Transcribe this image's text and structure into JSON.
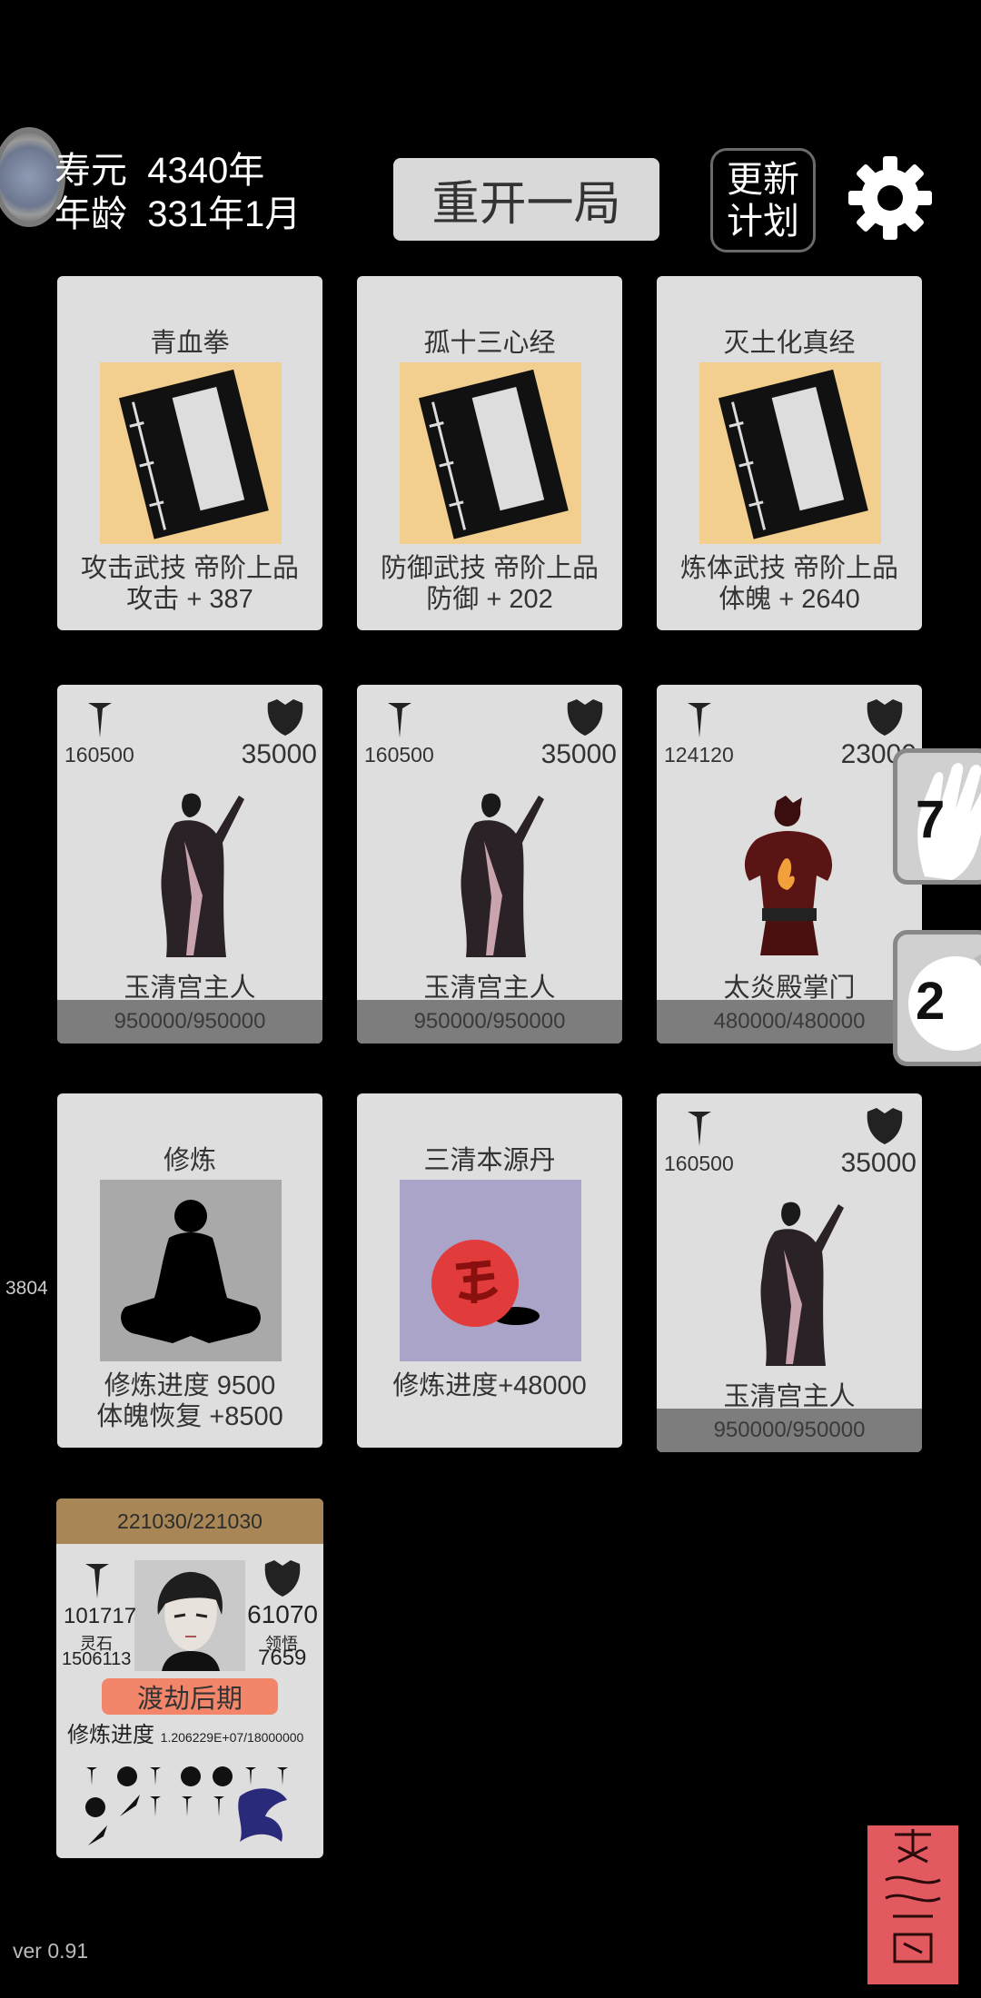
{
  "header": {
    "lifespan_label": "寿元",
    "lifespan_value": "4340年",
    "age_label": "年龄",
    "age_value": "331年1月",
    "restart_label": "重开一局",
    "plan_line1": "更新",
    "plan_line2": "计划"
  },
  "skills": [
    {
      "name": "青血拳",
      "type": "攻击武技  帝阶上品",
      "effect": "攻击 + 387"
    },
    {
      "name": "孤十三心经",
      "type": "防御武技  帝阶上品",
      "effect": "防御 + 202"
    },
    {
      "name": "灭土化真经",
      "type": "炼体武技  帝阶上品",
      "effect": "体魄 + 2640"
    }
  ],
  "enemies": [
    {
      "atk": "160500",
      "def": "35000",
      "name": "玉清宫主人",
      "hp": "950000/950000"
    },
    {
      "atk": "160500",
      "def": "35000",
      "name": "玉清宫主人",
      "hp": "950000/950000"
    },
    {
      "atk": "124120",
      "def": "23000",
      "name": "太炎殿掌门",
      "hp": "480000/480000"
    },
    {
      "atk": "160500",
      "def": "35000",
      "name": "玉清宫主人",
      "hp": "950000/950000"
    }
  ],
  "training": {
    "name": "修炼",
    "line1": "修炼进度  9500",
    "line2": "体魄恢复  +8500"
  },
  "pill": {
    "name": "三清本源丹",
    "line1": "修炼进度+48000"
  },
  "side_buttons": {
    "hand_count": "7",
    "sword_count": "2"
  },
  "left_number": "3804",
  "player": {
    "hp": "221030/221030",
    "atk": "101717",
    "def": "61070",
    "spirit_stone_label": "灵石",
    "spirit_stone": "1506113",
    "insight_label": "领悟",
    "insight": "7659",
    "realm": "渡劫后期",
    "progress_label": "修炼进度",
    "progress_value": "1.206229E+07/18000000"
  },
  "version": "ver 0.91",
  "colors": {
    "card_bg": "#dedede",
    "book_bg": "#f2cf8f",
    "pill_bg": "#aaa4c8",
    "training_bg": "#a9a9a9",
    "hp_bar": "#7d7d7d",
    "player_hp": "#a88655",
    "realm_badge": "#f3866a",
    "seal": "#e25a5f"
  }
}
